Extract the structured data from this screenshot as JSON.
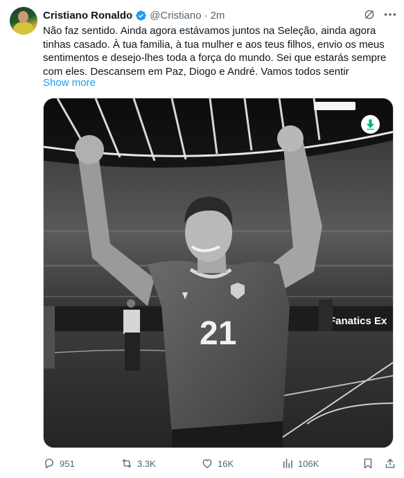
{
  "author": {
    "name": "Cristiano Ronaldo",
    "handle": "@Cristiano",
    "separator": "·",
    "time": "2m",
    "verified": true
  },
  "tweet": {
    "lines": [
      "Não faz sentido. Ainda agora estávamos juntos na Seleção, ainda agora",
      "tinhas casado. À tua familia, à tua mulher e aos teus filhos, envio os meus",
      "sentimentos e desejo-lhes toda a força do mundo. Sei que estarás sempre",
      "com eles. Descansem em Paz, Diogo e André. Vamos todos sentir"
    ],
    "show_more": "Show more"
  },
  "media": {
    "jersey_number": "21",
    "board_text": "Fanatics Ex",
    "board_text_left": "ics"
  },
  "actions": {
    "replies": "951",
    "retweets": "3.3K",
    "likes": "16K",
    "views": "106K"
  },
  "colors": {
    "text": "#0f1419",
    "secondary": "#536471",
    "link": "#1d9bf0",
    "verified": "#1d9bf0",
    "download": "#00ba7c"
  },
  "icons": {
    "grok": "grok-icon",
    "more": "more-icon",
    "reply": "reply-icon",
    "retweet": "retweet-icon",
    "like": "like-icon",
    "views": "views-icon",
    "bookmark": "bookmark-icon",
    "share": "share-icon",
    "download": "download-icon"
  }
}
